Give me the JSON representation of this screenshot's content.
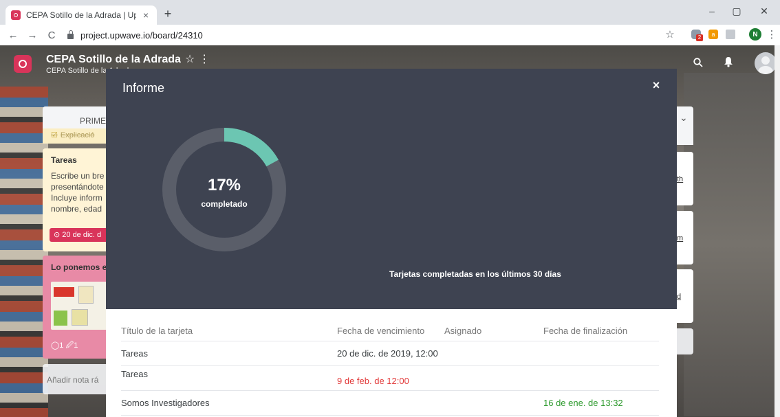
{
  "browser": {
    "tab_title": "CEPA Sotillo de la Adrada | Upwave",
    "tab_close": "×",
    "new_tab": "+",
    "minimize": "–",
    "maximize": "▢",
    "close": "✕",
    "back": "←",
    "forward": "→",
    "reload": "C",
    "url": "project.upwave.io/board/24310",
    "bookmark_star": "☆",
    "ext_badge": "2",
    "ext2_letter": "a",
    "profile_initial": "N",
    "menu": "⋮"
  },
  "app": {
    "board_title": "CEPA Sotillo de la Adrada",
    "board_star": "☆",
    "board_dots": "⋮",
    "board_subtitle": "CEPA Sotillo de la Adrada",
    "search_symbol": "⚲"
  },
  "board": {
    "column_header": "PRIME",
    "done_card": "Explicació",
    "card1_title": "Tareas",
    "card1_text": "Escribe un bre presentándote Incluye inform nombre, edad",
    "card1_due": "⊙ 20 de dic. d",
    "card2_title": "Lo ponemos e",
    "card2_meta": "◯1 🖉1",
    "add_note": "Añadir nota rá",
    "right_links": [
      "th",
      "m",
      "d"
    ],
    "check_symbol": "☑",
    "chevron": "⌄"
  },
  "modal": {
    "title": "Informe",
    "close": "×",
    "progress_percent": 17,
    "progress_label": "17%",
    "progress_sublabel": "completado",
    "chart_caption": "Tarjetas completadas en los últimos 30 días",
    "colors": {
      "done": "#6cc6b2",
      "remaining": "#5a5e69",
      "panel": "#3e4351"
    },
    "table": {
      "headers": [
        "Título de la tarjeta",
        "Fecha de vencimiento",
        "Asignado",
        "Fecha de finalización"
      ],
      "rows": [
        {
          "title": "Tareas",
          "due": "20 de dic. de 2019, 12:00",
          "assigned": "",
          "finished": ""
        },
        {
          "title": "Tareas",
          "due": "9 de feb. de 12:00",
          "assigned": "",
          "finished": ""
        },
        {
          "title": "Somos Investigadores",
          "due": "",
          "assigned": "",
          "finished": "16 de ene. de 13:32"
        }
      ]
    }
  }
}
